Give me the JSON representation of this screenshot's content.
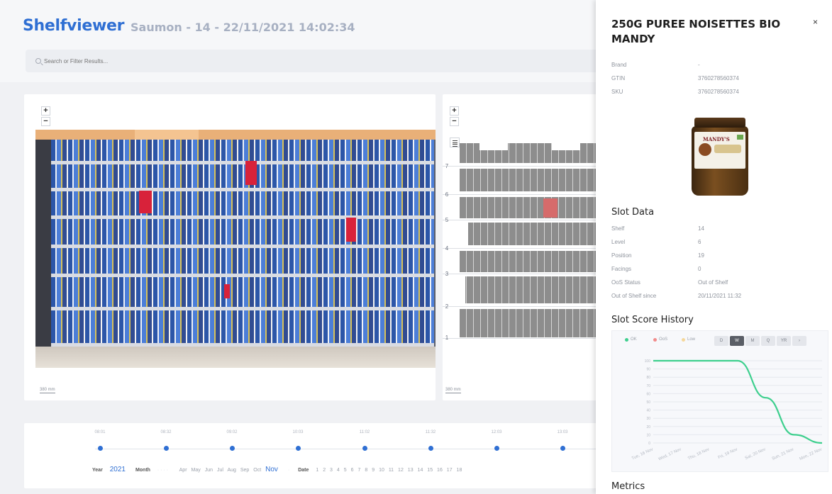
{
  "header": {
    "brand": "Shelfviewer",
    "subtitle": "Saumon - 14 - 22/11/2021 14:02:34",
    "search_placeholder": "Search or Filter Results..."
  },
  "photo_panel": {
    "scale_label": "380 mm"
  },
  "map_panel": {
    "scale_label": "380 mm",
    "level_labels": [
      "7",
      "6",
      "5",
      "4",
      "3",
      "2",
      "1"
    ]
  },
  "timeline": {
    "times": [
      "08:01",
      "08:32",
      "09:02",
      "10:03",
      "11:02",
      "11:32",
      "12:03",
      "13:03"
    ],
    "year_label": "Year",
    "year_value": "2021",
    "month_label": "Month",
    "months": [
      "Apr",
      "May",
      "Jun",
      "Jul",
      "Aug",
      "Sep",
      "Oct"
    ],
    "selected_month": "Nov",
    "date_label": "Date",
    "dates": [
      "1",
      "2",
      "3",
      "4",
      "5",
      "6",
      "7",
      "8",
      "9",
      "10",
      "11",
      "12",
      "13",
      "14",
      "15",
      "16",
      "17",
      "18"
    ]
  },
  "detail": {
    "title": "250G PUREE NOISETTES BIO MANDY",
    "close_glyph": "×",
    "product": [
      {
        "key": "Brand",
        "value": "-"
      },
      {
        "key": "GTIN",
        "value": "3760278560374"
      },
      {
        "key": "SKU",
        "value": "3760278560374"
      }
    ],
    "jar_brand": "MANDY'S",
    "slot_data_heading": "Slot Data",
    "slot": [
      {
        "key": "Shelf",
        "value": "14"
      },
      {
        "key": "Level",
        "value": "6"
      },
      {
        "key": "Position",
        "value": "19"
      },
      {
        "key": "Facings",
        "value": "0"
      },
      {
        "key": "OoS Status",
        "value": "Out of Shelf"
      },
      {
        "key": "Out of Shelf since",
        "value": "20/11/2021 11:32"
      }
    ],
    "history_heading": "Slot Score History",
    "legend": [
      "OK",
      "OoS",
      "Low"
    ],
    "ranges": [
      "D",
      "W",
      "M",
      "Q",
      "YR",
      "›"
    ],
    "active_range": "W",
    "metrics_heading": "Metrics"
  },
  "colors": {
    "brand": "#2f6fd3",
    "ok": "#3ecf8e",
    "oos": "#f28b8b",
    "low": "#f5d79a",
    "oos_marker": "#d8223a"
  },
  "chart_data": {
    "type": "line",
    "x": [
      "Tue, 16 Nov",
      "Wed, 17 Nov",
      "Thu, 18 Nov",
      "Fri, 19 Nov",
      "Sat, 20 Nov",
      "Sun, 21 Nov",
      "Mon, 22 Nov"
    ],
    "series": [
      {
        "name": "OK",
        "values": [
          100,
          100,
          100,
          100,
          55,
          10,
          0
        ]
      }
    ],
    "ylim": [
      0,
      100
    ],
    "ytick_labels": [
      "100",
      "90",
      "80",
      "70",
      "60",
      "50",
      "40",
      "30",
      "20",
      "10",
      "0"
    ],
    "grid": true,
    "legend_position": "top-left"
  }
}
